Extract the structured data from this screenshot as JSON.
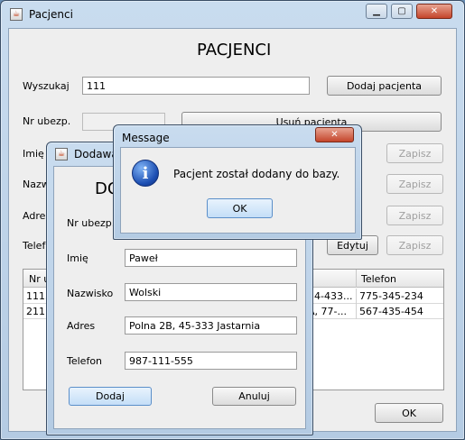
{
  "main_window": {
    "title": "Pacjenci",
    "heading": "PACJENCI",
    "search_label": "Wyszukaj",
    "search_value": "111",
    "add_patient_button": "Dodaj pacjenta",
    "insurance_label": "Nr ubezp.",
    "delete_patient_button": "Usuń pacjenta",
    "first_name_label": "Imię",
    "last_name_label": "Nazwisko",
    "address_label": "Adres",
    "phone_label": "Telefon",
    "save_label": "Zapisz",
    "edit_label": "Edytuj",
    "ok_button": "OK",
    "table": {
      "col_left": "Nr ub",
      "col_right": "Telefon",
      "rows": [
        {
          "left": "11155",
          "mid": "34-433...",
          "phone": "775-345-234"
        },
        {
          "left": "21115",
          "mid": "A, 77-...",
          "phone": "567-435-454"
        }
      ]
    }
  },
  "add_dialog": {
    "title": "Dodawa",
    "heading": "DO",
    "insurance_label": "Nr ubezp.",
    "first_name_label": "Imię",
    "first_name_value": "Paweł",
    "last_name_label": "Nazwisko",
    "last_name_value": "Wolski",
    "address_label": "Adres",
    "address_value": "Polna 2B, 45-333 Jastarnia",
    "phone_label": "Telefon",
    "phone_value": "987-111-555",
    "add_button": "Dodaj",
    "cancel_button": "Anuluj"
  },
  "message_dialog": {
    "title": "Message",
    "text": "Pacjent został dodany do bazy.",
    "ok_button": "OK",
    "icon": "info-icon"
  },
  "colors": {
    "desktop": "#6a8fb5",
    "frame": "#c1d5ea",
    "info_blue": "#1d4fb3",
    "close_red": "#c4452b"
  }
}
